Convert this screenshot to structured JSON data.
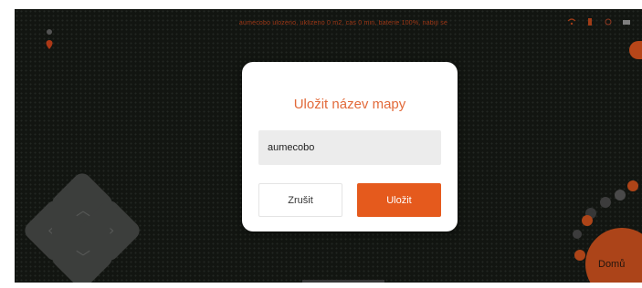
{
  "status_bar": {
    "text": "aumecobo ulozeno, uklizeno 0 m2, cas 0 min, baterie 100%, nabiji se"
  },
  "controls": {
    "big_button_label": "Domů"
  },
  "dialog": {
    "title": "Uložit název mapy",
    "input_value": "aumecobo",
    "cancel_label": "Zrušit",
    "save_label": "Uložit"
  },
  "colors": {
    "accent": "#e55a1d",
    "title": "#e26a3a",
    "background": "#171a15"
  },
  "icons": [
    "menu-dot-icon",
    "location-pin-icon",
    "wifi-icon",
    "battery-icon",
    "signal-icon",
    "settings-icon"
  ]
}
